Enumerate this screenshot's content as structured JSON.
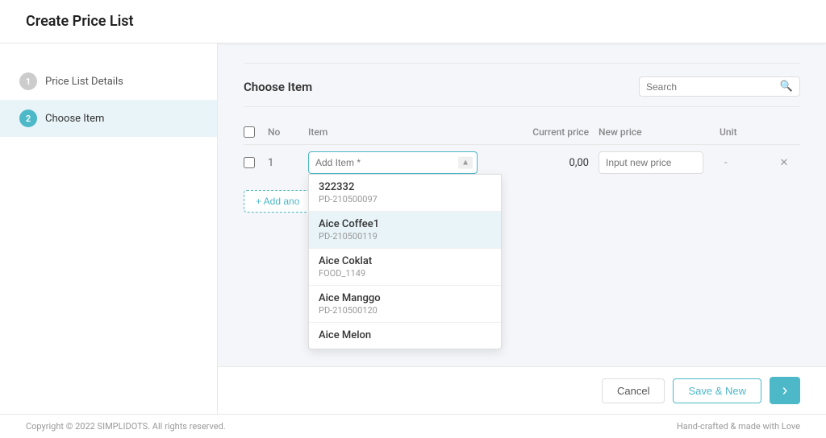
{
  "page": {
    "title": "Create Price List"
  },
  "sidebar": {
    "items": [
      {
        "id": "price-list-details",
        "step": "1",
        "label": "Price List Details",
        "active": false
      },
      {
        "id": "choose-item",
        "step": "2",
        "label": "Choose Item",
        "active": true
      }
    ]
  },
  "section": {
    "title": "Choose Item",
    "search_placeholder": "Search"
  },
  "table": {
    "headers": {
      "checkbox": "",
      "no": "No",
      "item": "Item",
      "current_price": "Current price",
      "new_price": "New price",
      "unit": "Unit"
    },
    "row": {
      "num": "1",
      "item_placeholder": "Add Item *",
      "current_price_value": "0,00",
      "new_price_placeholder": "Input new price",
      "unit_value": "-"
    }
  },
  "dropdown": {
    "items": [
      {
        "name": "322332",
        "code": "PD-210500097",
        "selected": false
      },
      {
        "name": "Aice Coffee1",
        "code": "PD-210500119",
        "selected": true
      },
      {
        "name": "Aice Coklat",
        "code": "FOOD_1149",
        "selected": false
      },
      {
        "name": "Aice Manggo",
        "code": "PD-210500120",
        "selected": false
      },
      {
        "name": "Aice Melon",
        "code": "",
        "selected": false
      }
    ]
  },
  "buttons": {
    "add_another": "+ Add ano",
    "cancel": "Cancel",
    "save_new": "Save & New",
    "go_arrow": "›"
  },
  "footer": {
    "copyright": "Copyright © 2022 SIMPLIDOTS. All rights reserved.",
    "tagline": "Hand-crafted & made with Love"
  }
}
